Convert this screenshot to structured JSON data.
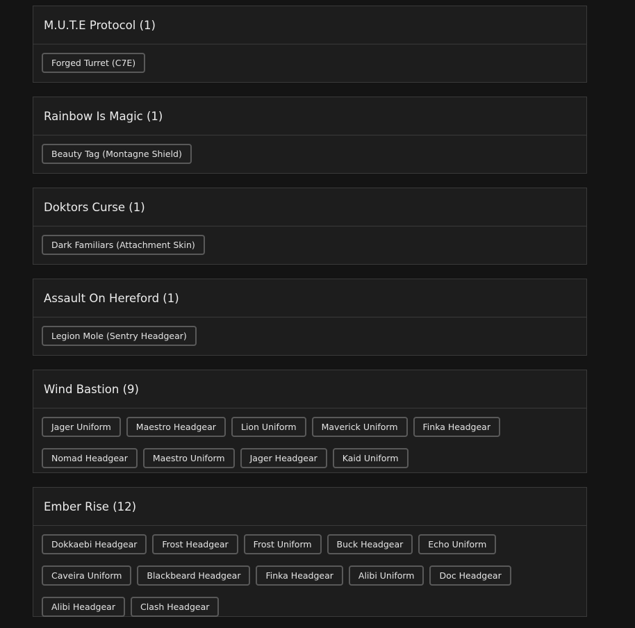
{
  "sections": [
    {
      "title": "M.U.T.E Protocol (1)",
      "items": [
        "Forged Turret (C7E)"
      ]
    },
    {
      "title": "Rainbow Is Magic (1)",
      "items": [
        "Beauty Tag (Montagne Shield)"
      ]
    },
    {
      "title": "Doktors Curse (1)",
      "items": [
        "Dark Familiars (Attachment Skin)"
      ]
    },
    {
      "title": "Assault On Hereford (1)",
      "items": [
        "Legion Mole (Sentry Headgear)"
      ]
    },
    {
      "title": "Wind Bastion (9)",
      "items": [
        "Jager Uniform",
        "Maestro Headgear",
        "Lion Uniform",
        "Maverick Uniform",
        "Finka Headgear",
        "Nomad Headgear",
        "Maestro Uniform",
        "Jager Headgear",
        "Kaid Uniform"
      ]
    },
    {
      "title": "Ember Rise (12)",
      "items": [
        "Dokkaebi Headgear",
        "Frost Headgear",
        "Frost Uniform",
        "Buck Headgear",
        "Echo Uniform",
        "Caveira Uniform",
        "Blackbeard Headgear",
        "Finka Headgear",
        "Alibi Uniform",
        "Doc Headgear",
        "Alibi Headgear",
        "Clash Headgear"
      ]
    }
  ],
  "colors": {
    "background": "#141414",
    "card": "#1d1d1d",
    "border": "#3a3a3a",
    "chip_border": "#595959",
    "text": "#e6e6e6"
  }
}
